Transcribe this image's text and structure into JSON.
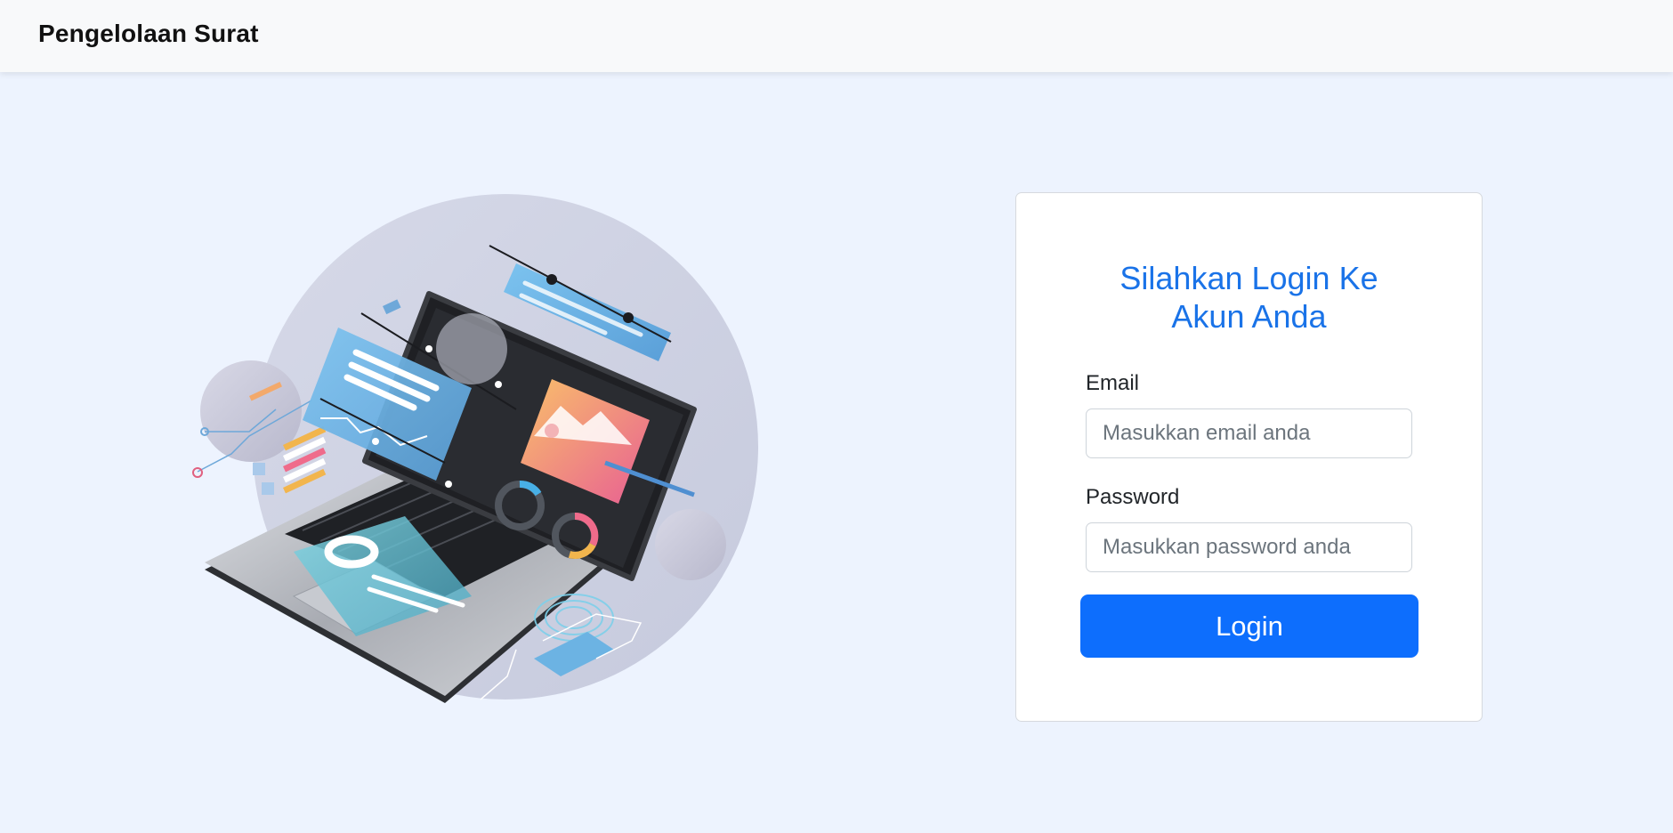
{
  "navbar": {
    "brand": "Pengelolaan Surat"
  },
  "login": {
    "title_line1": "Silahkan Login Ke",
    "title_line2": "Akun Anda",
    "email_label": "Email",
    "email_placeholder": "Masukkan email anda",
    "email_value": "",
    "password_label": "Password",
    "password_placeholder": "Masukkan password anda",
    "password_value": "",
    "submit_label": "Login"
  },
  "colors": {
    "page_bg": "#edf3fe",
    "navbar_bg": "#f8f9fa",
    "title": "#1a73e8",
    "primary_button": "#0d6efd"
  },
  "illustration": {
    "icon": "laptop-dashboard-illustration"
  }
}
